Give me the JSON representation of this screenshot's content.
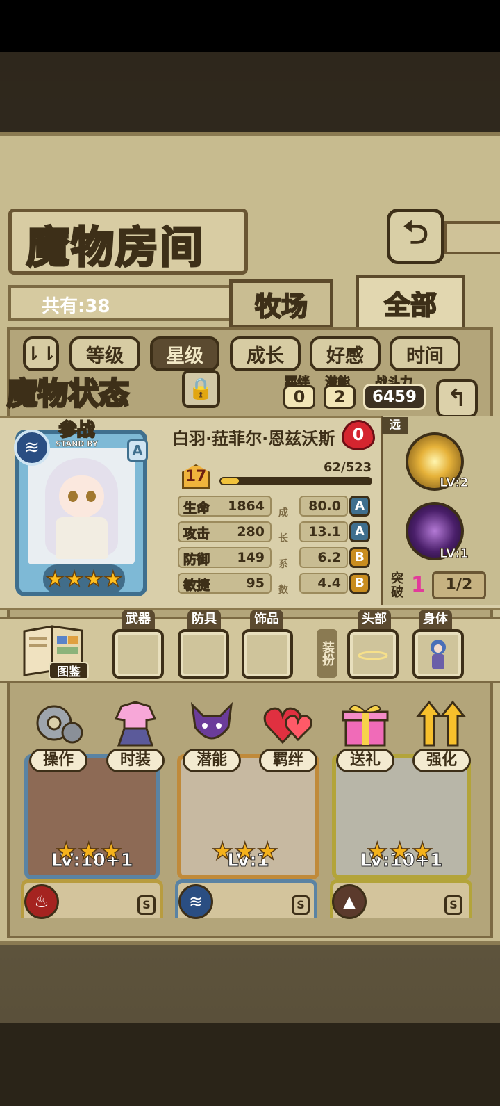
{
  "header": {
    "title": "魔物房间",
    "back_icon": "back-arrow-icon"
  },
  "collection": {
    "count_text": "共有:38",
    "tabs": [
      "牧场",
      "全部"
    ],
    "active_tab": "全部"
  },
  "sort": {
    "toggle_icon": "sort-toggle-icon",
    "options": [
      "等级",
      "星级",
      "成长",
      "好感",
      "时间"
    ],
    "active": "星级"
  },
  "status": {
    "title": "魔物状态",
    "bond_label": "羁绊",
    "bond_value": "0",
    "potential_label": "潜能",
    "potential_value": "2",
    "power_label": "战斗力",
    "power_value": "6459"
  },
  "character": {
    "standby_cn": "参战",
    "standby_en": "STAND BY",
    "rank": "A",
    "element_icon": "water-element-icon",
    "stars": 4,
    "star_glyph": "★",
    "name": "白羽·菈菲尔·恩兹沃斯",
    "affection": "0",
    "level": "17",
    "exp_text": "62/523",
    "exp_fraction": 0.1185,
    "stats": [
      {
        "label": "生命",
        "value": "1864",
        "growth": "80.0",
        "grade": "A"
      },
      {
        "label": "攻击",
        "value": "280",
        "growth": "13.1",
        "grade": "A"
      },
      {
        "label": "防御",
        "value": "149",
        "growth": "6.2",
        "grade": "B"
      },
      {
        "label": "敏捷",
        "value": "95",
        "growth": "4.4",
        "grade": "B"
      }
    ],
    "growth_chars": [
      "成",
      "长",
      "系",
      "数"
    ]
  },
  "skills": {
    "range": "远",
    "items": [
      {
        "lv": "LV:2",
        "icon": "holy-light-skill-icon"
      },
      {
        "lv": "LV:1",
        "icon": "shadow-skill-icon"
      }
    ],
    "break_label": "突破",
    "break_value": "1",
    "break_progress": "1/2"
  },
  "equipment": {
    "book_label": "图鉴",
    "slots": [
      "武器",
      "防具",
      "饰品",
      "头部",
      "身体"
    ],
    "dress_label": "装扮"
  },
  "actions": [
    {
      "label": "操作",
      "icon": "gear-icon"
    },
    {
      "label": "时装",
      "icon": "outfit-icon"
    },
    {
      "label": "潜能",
      "icon": "demon-potential-icon"
    },
    {
      "label": "羁绊",
      "icon": "hearts-icon"
    },
    {
      "label": "送礼",
      "icon": "gift-icon"
    },
    {
      "label": "强化",
      "icon": "upgrade-arrows-icon"
    }
  ],
  "grid": {
    "cards": [
      {
        "lv": "LV:10+1",
        "stars": 3
      },
      {
        "lv": "LV:1",
        "stars": 3
      },
      {
        "lv": "LV:10+1",
        "stars": 3
      }
    ],
    "bottom_badges": [
      "S",
      "S",
      "S"
    ]
  },
  "colors": {
    "frame": "#c7bb8f",
    "dark_outline": "#3d2f18",
    "grade_A": "#3f6f8e",
    "grade_B": "#c98d1f",
    "star": "#f5b21c",
    "heart": "#d5252f"
  }
}
